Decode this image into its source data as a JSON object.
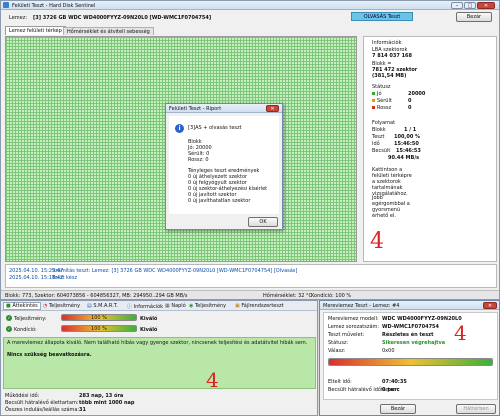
{
  "main_window": {
    "title": "Felületi Teszt - Hard Disk Sentinel",
    "disk_label": "Lemez:",
    "disk_value": "[3] 3726 GB  WDC WD4000FYYZ-09N20L0 [WD-WMC1F0704754]",
    "mode_badge": "OLVASÁS Teszt",
    "close_button": "Bezár",
    "tabs": [
      "Lemez felületi térkép",
      "Hőmérséklet és átviteli sebesség"
    ],
    "side_panel": {
      "info_title": "Információk",
      "lba_label": "LBA szektorok",
      "lba_value": "7 814 037 168",
      "block_label": "Blokk =",
      "block_value": "781 472 szektor",
      "block_size": "(381,54 MB)",
      "status_title": "Státusz",
      "status_rows": [
        {
          "label": "Jó",
          "value": "20000",
          "color": "#2fa82f"
        },
        {
          "label": "Sérült",
          "value": "0",
          "color": "#e0a000"
        },
        {
          "label": "Rossz",
          "value": "0",
          "color": "#d03030"
        }
      ],
      "progress_title": "Folyamat",
      "progress_rows": [
        {
          "label": "Blokk",
          "value": "1 / 1"
        },
        {
          "label": "Teszt",
          "value": "100,00 %"
        },
        {
          "label": "Idő",
          "value": "15:46:50"
        },
        {
          "label": "Becsült",
          "value": "15:46:53"
        },
        {
          "label": "",
          "value": "90.44 MB/s"
        }
      ],
      "hint1": "Kattintson a felületi térképre a szektorok tartalmának vizsgálatához.",
      "hint2": "Jobb egérgombbal a gyorsmenü érhető el.",
      "handwritten_mark": "4"
    },
    "log_lines": [
      {
        "time": "2025.04.10.  15:29:47",
        "text": "Számítás teszt: Lemez: [3] 3726 GB  WDC WD4000FYYZ-09N20L0 [WD-WMC1F0704754] [Olvasás]"
      },
      {
        "time": "2025.04.10.  15:18:42",
        "text": "Teszt kész"
      }
    ],
    "status_bar": {
      "left": "Blokk: 773, Szektor: 604073856 - 604856327, MB: 294950..294 GB MB/s",
      "temp": "Hőmérséklet: 32 °C",
      "condition": "Kondíció: 100 %"
    }
  },
  "report_dialog": {
    "title": "Felületi Teszt - Riport",
    "test_name": "[3]AS + olvasás teszt",
    "blocks_label": "Blokk",
    "good": "Jó: 20000",
    "damaged": "Sérült: 0",
    "bad": "Rossz: 0",
    "results_title": "Tényleges teszt eredmények",
    "results": [
      "0 új áthelyezett szektor",
      "0 új felgyógyult szektor",
      "0 új szektor-áthelyezési kísérlet",
      "0 új javított szektor",
      "0 új javíthatatlan szektor"
    ],
    "ok_button": "OK"
  },
  "lower_window": {
    "toolbar": [
      "Áttekintés",
      "Teljesítmény",
      "S.M.A.R.T.",
      "Információk",
      "Napló",
      "Teljesítmény",
      "Fájlrendszerteszt"
    ],
    "perf_label": "Teljesítmény:",
    "perf_value": "100 %",
    "perf_rating": "Kiváló",
    "cond_label": "Kondíció:",
    "cond_value": "100 %",
    "cond_rating": "Kiváló",
    "message_text": "A merevlemez állapota kiváló. Nem található hibás vagy gyenge szektor, nincsenek teljesítési és adatátvitel hibák sem.",
    "action_text": "Nincs szükség beavatkozásra.",
    "handwritten_mark": "4",
    "stats": [
      {
        "label": "Működési idő:",
        "value": "283 nap, 13 óra"
      },
      {
        "label": "Becsült hátralévő élettartam:",
        "value": "több mint 1000 nap"
      },
      {
        "label": "Összes indulás/leállás száma:",
        "value": "31"
      }
    ]
  },
  "test_dialog": {
    "title": "Merevlemez Teszt - Lemez: #4",
    "rows": [
      {
        "label": "Merevlemez modell:",
        "value": "WDC WD4000FYYZ-09N20L0"
      },
      {
        "label": "Lemez sorozatszám:",
        "value": "WD-WMC1F0704754"
      },
      {
        "label": "Teszt művelet:",
        "value": "Részletes én teszt"
      },
      {
        "label": "Státusz:",
        "value": "Sikeresen végrehajtva"
      },
      {
        "label": "Válasz:",
        "value": "0x00"
      }
    ],
    "progress_percent": 100,
    "elapsed_label": "Eltelt idő:",
    "elapsed_value": "07:40:35",
    "remaining_label": "Becsült hátralévő időtartam:",
    "remaining_value": "0 perc",
    "close_button": "Bezár",
    "hide_button": "Háttérben",
    "handwritten_mark": "4"
  },
  "colors": {
    "accent": "#0b4fa8",
    "good_green": "#2fa82f",
    "badge_blue": "#69c4e8"
  }
}
